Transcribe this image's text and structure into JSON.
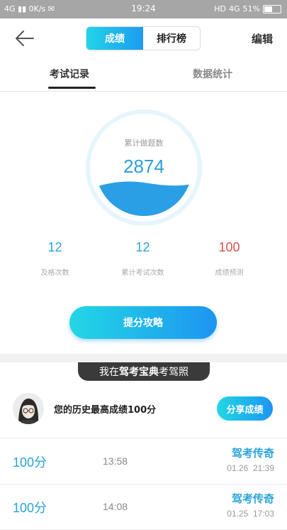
{
  "status": {
    "network": "4G",
    "speed": "0K/s",
    "time": "19:24",
    "hd": "HD",
    "network2": "4G",
    "battery": "51%",
    "battery_level": 0.51
  },
  "header": {
    "tabs": [
      "成绩",
      "排行榜"
    ],
    "active_tab": 0,
    "edit_label": "编辑"
  },
  "subtabs": {
    "records": "考试记录",
    "stats": "数据统计"
  },
  "gauge": {
    "label": "累计做题数",
    "value": "2874"
  },
  "stats": [
    {
      "value": "12",
      "label": "及格次数",
      "color": "#2aa3d8"
    },
    {
      "value": "12",
      "label": "累计考试次数",
      "color": "#2aa3d8"
    },
    {
      "value": "100",
      "label": "成绩预测",
      "color": "#d9534f"
    }
  ],
  "tips_button": "提分攻略",
  "banner": {
    "prefix": "我在",
    "brand": "驾考宝典",
    "suffix": "考驾照"
  },
  "best": {
    "text": "您的历史最高成绩100分",
    "share_label": "分享成绩"
  },
  "records": [
    {
      "score": "100分",
      "duration": "13:58",
      "title": "驾考传奇",
      "date": "01.26",
      "time": "21:39"
    },
    {
      "score": "100分",
      "duration": "14:08",
      "title": "驾考传奇",
      "date": "01.25",
      "time": "17:03"
    }
  ],
  "colors": {
    "accent": "#1e9bf0",
    "accent_light": "#21d4e9",
    "danger": "#d9534f"
  }
}
